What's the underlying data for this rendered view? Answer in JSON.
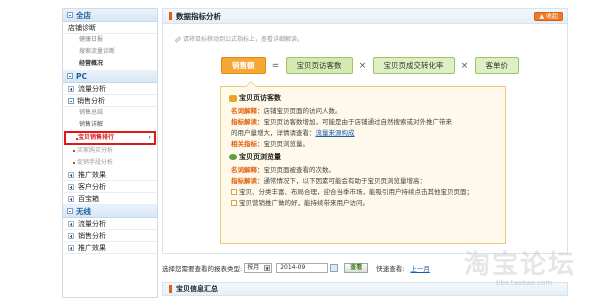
{
  "sidebar": {
    "sections": [
      {
        "title": "全店"
      },
      {
        "title": "PC"
      },
      {
        "title": "无线"
      }
    ],
    "store_items": [
      "店铺诊断",
      "健康日报",
      "搜索流量诊断",
      "经营概况"
    ],
    "pc_items": [
      "流量分析",
      "销售分析",
      "销售总结",
      "销售详解",
      "宝贝销售排行",
      "买家购买分析",
      "促销手段分析",
      "推广效果",
      "客户分析",
      "百宝箱"
    ],
    "wireless_items": [
      "流量分析",
      "销售分析",
      "推广效果"
    ],
    "active_arrow": "›"
  },
  "main": {
    "title": "数据指标分析",
    "collapse_label": "▲ 收起",
    "hint": "请将鼠标移动到公式指标上，查看详细解读。",
    "formula": {
      "result": "销售额",
      "equals": "=",
      "terms": [
        "宝贝页访客数",
        "宝贝页成交转化率",
        "客单价"
      ],
      "times": "×"
    },
    "detail": {
      "visitors": {
        "heading": "宝贝页访客数",
        "name_label": "名词解释：",
        "name_text": "店铺宝贝页面的访问人数。",
        "guide_label": "指标解读：",
        "guide_text_1": "宝贝页访客数增加，可能是由于店铺通过自然搜索或对外推广带来",
        "guide_text_2": "的用户量增大，详情请查看：",
        "guide_link": "流量来源构成",
        "related_label": "相关指标：",
        "related_text": "宝贝页浏览量。"
      },
      "pageviews": {
        "heading": "宝贝页浏览量",
        "name_label": "名词解释：",
        "name_text": "宝贝页面被查看的次数。",
        "guide_label": "指标解读：",
        "guide_text": "通常情况下，以下因素可能会有助于宝贝页浏览量增高：",
        "bullet_1": "宝贝、分类丰富、布局合理，迎合当季市场，能吸引用户持续点击其他宝贝页面；",
        "bullet_2": "宝贝营销推广做的好，能持续带来用户访问。"
      }
    }
  },
  "filter": {
    "label": "选择您需要查看的报表类型:",
    "period": "按月",
    "date": "2014-09",
    "view_label": "查看",
    "quick_label": "快速查看:",
    "quick_link": "上一月"
  },
  "info": {
    "title": "宝贝信息汇总"
  },
  "watermark": {
    "main": "淘宝论坛",
    "sub": "bbs.taobao.com"
  },
  "colors": {
    "accent": "#f07a24",
    "formula_green": "#dfefc4",
    "active_border": "#e01818"
  }
}
